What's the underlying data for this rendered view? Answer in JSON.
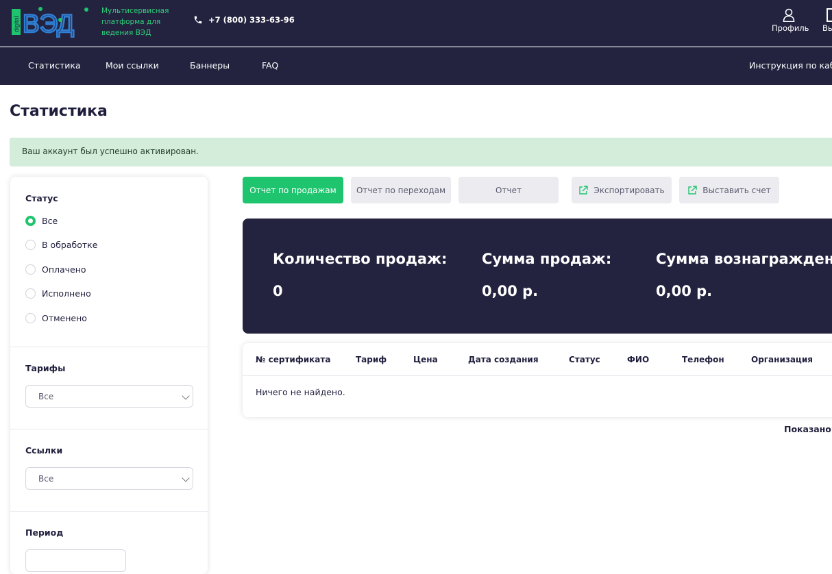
{
  "header": {
    "logo_side_text": "digital",
    "logo_text": "ВЭД",
    "tagline": "Мультисервисная платформа для ведения ВЭД",
    "phone": "+7 (800) 333-63-96",
    "profile_label": "Профиль",
    "logout_label": "Вы"
  },
  "nav": {
    "items": [
      "Статистика",
      "Мои ссылки",
      "Баннеры",
      "FAQ"
    ],
    "instructions": "Инструкция по кабин"
  },
  "page": {
    "title": "Статистика",
    "alert": "Ваш аккаунт был успешно активирован."
  },
  "filters": {
    "status_title": "Статус",
    "status_options": [
      "Все",
      "В обработке",
      "Оплачено",
      "Исполнено",
      "Отменено"
    ],
    "status_selected": "Все",
    "tariffs_title": "Тарифы",
    "tariffs_value": "Все",
    "links_title": "Ссылки",
    "links_value": "Все",
    "period_title": "Период"
  },
  "actions": {
    "sales_report": "Отчет по продажам",
    "clicks_report": "Отчет по переходам",
    "report": "Отчет",
    "export": "Экспортировать",
    "invoice": "Выставить счет"
  },
  "summary": {
    "sales_count_label": "Количество продаж:",
    "sales_count_value": "0",
    "sales_sum_label": "Сумма продаж:",
    "sales_sum_value": "0,00 р.",
    "reward_sum_label": "Сумма вознаграждения:",
    "reward_sum_value": "0,00 р."
  },
  "table": {
    "columns": [
      "№ сертификата",
      "Тариф",
      "Цена",
      "Дата создания",
      "Статус",
      "ФИО",
      "Телефон",
      "Организация"
    ],
    "empty_text": "Ничего не найдено."
  },
  "footer": {
    "shown_label": "Показано",
    "shown_tail": "("
  },
  "colors": {
    "dark": "#23233f",
    "green": "#1ec46e",
    "alert_bg": "#d4eddb",
    "logo_blue": "#2f7fd6"
  }
}
